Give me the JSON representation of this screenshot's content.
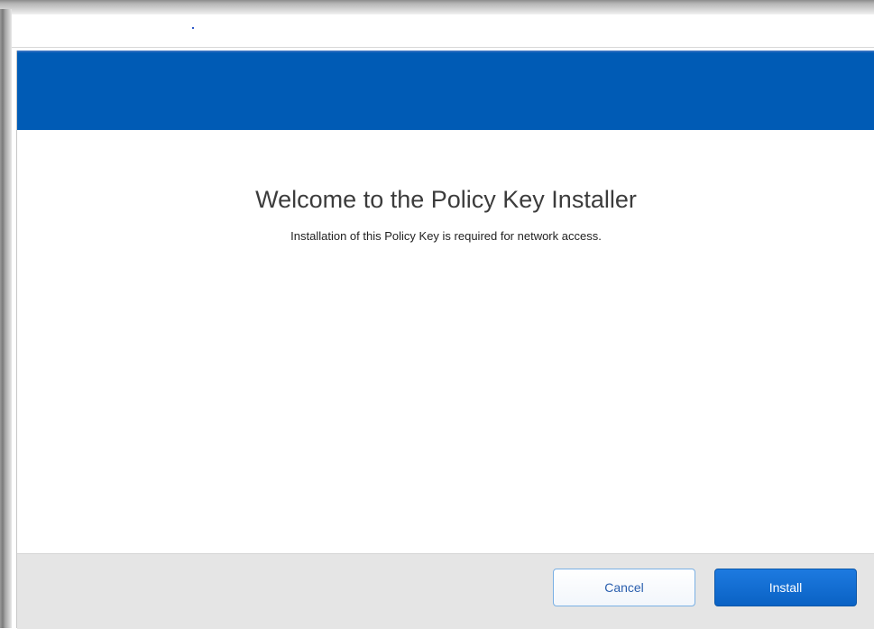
{
  "dialog": {
    "title": "Welcome to the Policy Key Installer",
    "subtitle": "Installation of this Policy Key is required for network access."
  },
  "footer": {
    "cancel_label": "Cancel",
    "install_label": "Install"
  },
  "colors": {
    "header_blue": "#005bb5",
    "install_button": "#1d7ae0",
    "footer_background": "#e5e5e5"
  }
}
